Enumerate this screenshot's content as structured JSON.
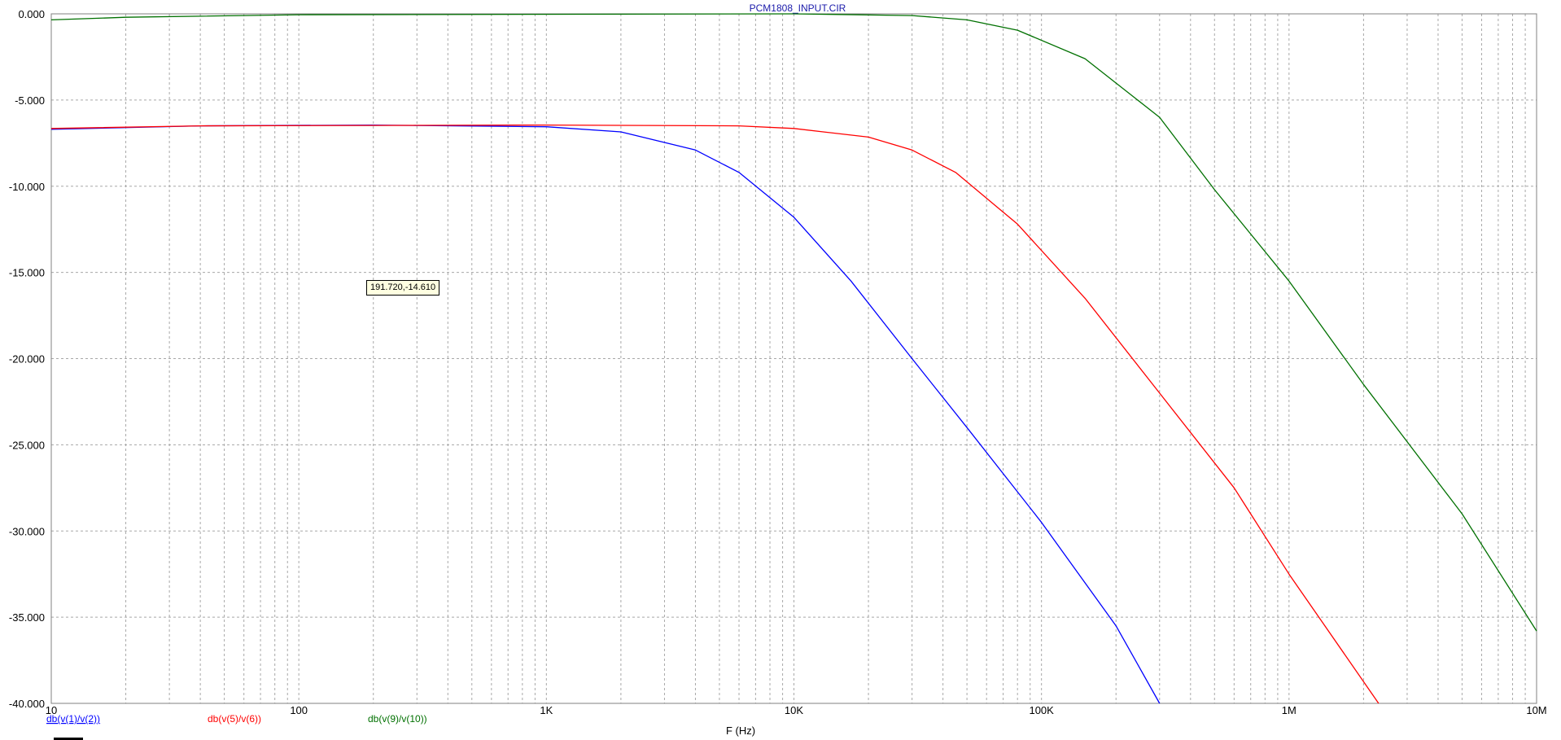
{
  "window": {
    "title": "PCM1808_INPUT.CIR"
  },
  "cursor": {
    "readout": "191.720,-14.610"
  },
  "chart_data": {
    "type": "line",
    "title": "PCM1808_INPUT.CIR",
    "xlabel": "F (Hz)",
    "ylabel": "",
    "xscale": "log",
    "xlim": [
      10,
      10000000
    ],
    "ylim": [
      -40,
      0
    ],
    "grid": true,
    "legend_position": "bottom-left",
    "x_tick_values": [
      10,
      100,
      1000,
      10000,
      100000,
      1000000,
      10000000
    ],
    "x_tick_labels": [
      "10",
      "100",
      "1K",
      "10K",
      "100K",
      "1M",
      "10M"
    ],
    "y_tick_values": [
      0,
      -5,
      -10,
      -15,
      -20,
      -25,
      -30,
      -35,
      -40
    ],
    "y_tick_labels": [
      "0.000",
      "-5.000",
      "-10.000",
      "-15.000",
      "-20.000",
      "-25.000",
      "-30.000",
      "-35.000",
      "-40.000"
    ],
    "series": [
      {
        "name": "db(v(1)/v(2))",
        "color": "#0000ff",
        "points": [
          [
            10,
            -6.7
          ],
          [
            40,
            -6.5
          ],
          [
            200,
            -6.45
          ],
          [
            1000,
            -6.55
          ],
          [
            2000,
            -6.85
          ],
          [
            4000,
            -7.9
          ],
          [
            6000,
            -9.2
          ],
          [
            10000,
            -11.8
          ],
          [
            17000,
            -15.5
          ],
          [
            30000,
            -20.0
          ],
          [
            50000,
            -24.0
          ],
          [
            100000,
            -29.5
          ],
          [
            200000,
            -35.5
          ],
          [
            300000,
            -40.0
          ]
        ]
      },
      {
        "name": "db(v(5)/v(6))",
        "color": "#ff0000",
        "points": [
          [
            10,
            -6.65
          ],
          [
            40,
            -6.5
          ],
          [
            1000,
            -6.45
          ],
          [
            6000,
            -6.5
          ],
          [
            10000,
            -6.65
          ],
          [
            20000,
            -7.15
          ],
          [
            30000,
            -7.9
          ],
          [
            45000,
            -9.2
          ],
          [
            80000,
            -12.2
          ],
          [
            150000,
            -16.5
          ],
          [
            300000,
            -22.0
          ],
          [
            600000,
            -27.5
          ],
          [
            1000000,
            -32.5
          ],
          [
            2300000,
            -40.0
          ]
        ]
      },
      {
        "name": "db(v(9)/v(10))",
        "color": "#007000",
        "points": [
          [
            10,
            -0.35
          ],
          [
            20,
            -0.2
          ],
          [
            100,
            -0.05
          ],
          [
            10000,
            0.0
          ],
          [
            30000,
            -0.1
          ],
          [
            50000,
            -0.35
          ],
          [
            80000,
            -0.95
          ],
          [
            150000,
            -2.6
          ],
          [
            300000,
            -6.0
          ],
          [
            500000,
            -10.2
          ],
          [
            1000000,
            -15.5
          ],
          [
            2000000,
            -21.5
          ],
          [
            5000000,
            -29.0
          ],
          [
            10000000,
            -35.8
          ]
        ]
      }
    ]
  }
}
